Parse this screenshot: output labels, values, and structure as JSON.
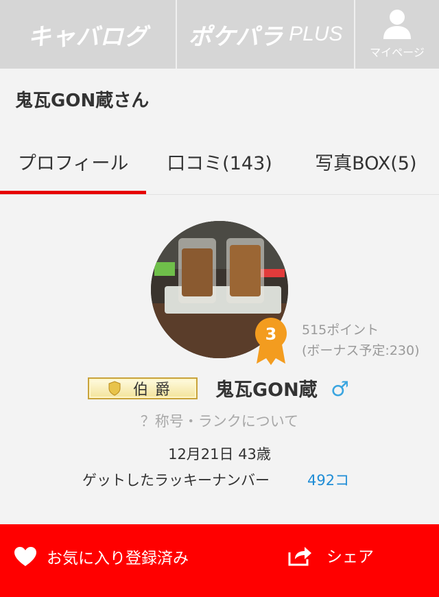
{
  "nav": {
    "logo_left": "キャバログ",
    "logo_right": "ポケパラ",
    "logo_right_suffix": "PLUS",
    "mypage_label": "マイページ",
    "mypage_icon": "person-icon"
  },
  "header": {
    "title": "鬼瓦GON蔵さん"
  },
  "tabs": [
    {
      "label": "プロフィール",
      "active": true
    },
    {
      "label": "口コミ(143)",
      "active": false
    },
    {
      "label": "写真BOX(5)",
      "active": false
    }
  ],
  "profile": {
    "rank_number": "3",
    "points": "515ポイント",
    "bonus": "(ボーナス予定:230)",
    "title_badge": "伯爵",
    "nickname": "鬼瓦GON蔵",
    "gender_symbol": "♂",
    "rank_link": "？称号・ランクについて",
    "birth_age": "12月21日 43歳",
    "lucky_label": "ゲットしたラッキーナンバー",
    "lucky_count": "492コ"
  },
  "bottom_bar": {
    "favorite_label": "お気に入り登録済み",
    "favorite_icon": "heart-icon",
    "share_label": "シェア",
    "share_icon": "share-icon"
  },
  "colors": {
    "accent_red": "#ff0000",
    "tab_underline": "#e60000",
    "link_blue": "#1f8dd6",
    "gender_blue": "#3aa5e0",
    "medal_orange": "#f39c1f",
    "nav_gray": "#d6d6d6"
  }
}
